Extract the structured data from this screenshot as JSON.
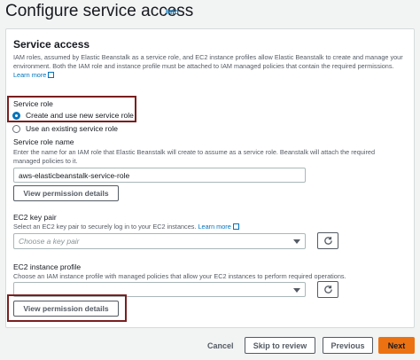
{
  "header": {
    "title": "Configure service access",
    "info_label": "Info"
  },
  "section": {
    "title": "Service access",
    "description": "IAM roles, assumed by Elastic Beanstalk as a service role, and EC2 instance profiles allow Elastic Beanstalk to create and manage your environment. Both the IAM role and instance profile must be attached to IAM managed policies that contain the required permissions.",
    "learn_more": "Learn more"
  },
  "service_role": {
    "label": "Service role",
    "options": [
      {
        "label": "Create and use new service role",
        "selected": true
      },
      {
        "label": "Use an existing service role",
        "selected": false
      }
    ]
  },
  "service_role_name": {
    "label": "Service role name",
    "description": "Enter the name for an IAM role that Elastic Beanstalk will create to assume as a service role. Beanstalk will attach the required managed policies to it.",
    "value": "aws-elasticbeanstalk-service-role",
    "view_permissions_label": "View permission details"
  },
  "ec2_key_pair": {
    "label": "EC2 key pair",
    "description": "Select an EC2 key pair to securely log in to your EC2 instances.",
    "learn_more": "Learn more",
    "placeholder": "Choose a key pair"
  },
  "ec2_instance_profile": {
    "label": "EC2 instance profile",
    "description": "Choose an IAM instance profile with managed policies that allow your EC2 instances to perform required operations.",
    "value": "",
    "view_permissions_label": "View permission details"
  },
  "footer": {
    "cancel_label": "Cancel",
    "skip_label": "Skip to review",
    "previous_label": "Previous",
    "next_label": "Next"
  },
  "colors": {
    "link": "#0073bb",
    "primary": "#ec7211",
    "highlight": "#7a1f1f"
  }
}
